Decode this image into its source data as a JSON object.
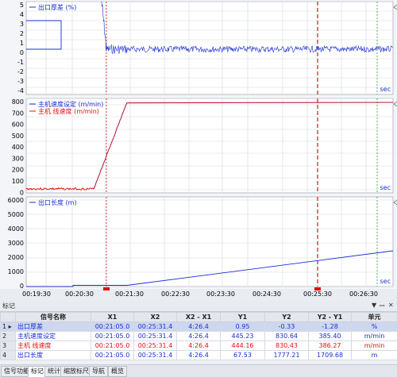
{
  "chart_data": [
    {
      "type": "line",
      "series": [
        {
          "name": "出口厚差",
          "unit": "(%)",
          "color": "#1a2fd0"
        }
      ],
      "y_ticks": [
        "5",
        "4",
        "3",
        "2",
        "1",
        "0",
        "-1",
        "-2",
        "-3",
        "-4"
      ],
      "ylim": [
        -5,
        5
      ],
      "unit_label": "sec"
    },
    {
      "type": "line",
      "series": [
        {
          "name": "主机速度设定",
          "unit": "(m/min)",
          "color": "#1a2fd0"
        },
        {
          "name": "主机 线速度",
          "unit": "(m/min)",
          "color": "#e01010"
        }
      ],
      "y_ticks": [
        "800",
        "700",
        "600",
        "500",
        "400",
        "300",
        "200",
        "100",
        "0"
      ],
      "ylim": [
        0,
        850
      ],
      "unit_label": "sec"
    },
    {
      "type": "line",
      "series": [
        {
          "name": "出口长度",
          "unit": "(m)",
          "color": "#1a2fd0"
        }
      ],
      "y_ticks": [
        "6000",
        "5000",
        "4000",
        "3000",
        "2000",
        "1000",
        "0"
      ],
      "ylim": [
        0,
        6000
      ],
      "unit_label": "sec"
    }
  ],
  "x_axis": {
    "ticks": [
      "00:19:30",
      "00:20:30",
      "00:21:30",
      "00:22:30",
      "00:23:30",
      "00:24:30",
      "00:25:30",
      "00:26:30"
    ]
  },
  "marker_panel": {
    "title": "标记",
    "close_icon": "close-icon",
    "pin_icon": "pin-icon",
    "headers": [
      "信号名称",
      "X1",
      "X2",
      "X2 - X1",
      "Y1",
      "Y2",
      "Y2 - Y1",
      "单元"
    ],
    "rows": [
      {
        "index": "1",
        "arrow": "▸",
        "name": "出口厚差",
        "x1": "00:21:05.0",
        "x2": "00:25:31.4",
        "dx": "4:26.4",
        "y1": "0.95",
        "y2": "-0.33",
        "dy": "-1.28",
        "unit": "%",
        "color": "#1a2fd0"
      },
      {
        "index": "2",
        "arrow": "",
        "name": "主机速度设定",
        "x1": "00:21:05.0",
        "x2": "00:25:31.4",
        "dx": "4:26.4",
        "y1": "445.23",
        "y2": "830.64",
        "dy": "385.40",
        "unit": "m/min",
        "color": "#1a2fd0"
      },
      {
        "index": "3",
        "arrow": "",
        "name": "主机 线速度",
        "x1": "00:21:05.0",
        "x2": "00:25:31.4",
        "dx": "4:26.4",
        "y1": "444.16",
        "y2": "830.43",
        "dy": "386.27",
        "unit": "m/min",
        "color": "#e01010"
      },
      {
        "index": "4",
        "arrow": "",
        "name": "出口长度",
        "x1": "00:21:05.0",
        "x2": "00:25:31.4",
        "dx": "4:26.4",
        "y1": "67.53",
        "y2": "1777.21",
        "dy": "1709.68",
        "unit": "m",
        "color": "#1a2fd0"
      }
    ]
  },
  "tabs": [
    "信号功能",
    "标记",
    "统计",
    "缩放标尺",
    "导航",
    "概览"
  ],
  "active_tab": "标记"
}
